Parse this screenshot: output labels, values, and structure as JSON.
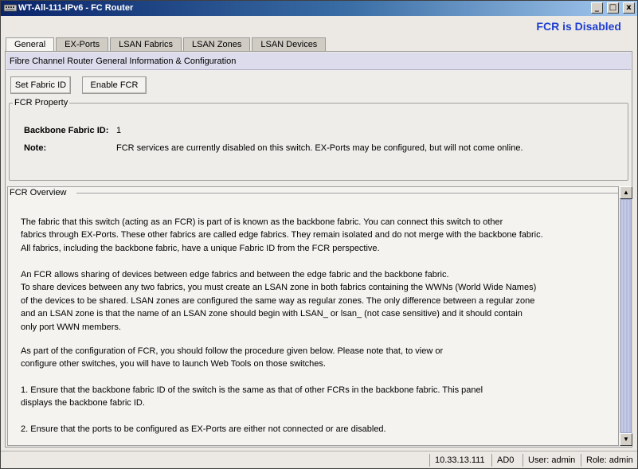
{
  "window": {
    "title": "WT-All-111-IPv6 - FC Router",
    "minimize_glyph": "_",
    "maximize_glyph": "□",
    "close_glyph": "x"
  },
  "status_banner": "FCR is Disabled",
  "tabs": [
    {
      "label": "General",
      "active": true
    },
    {
      "label": "EX-Ports",
      "active": false
    },
    {
      "label": "LSAN Fabrics",
      "active": false
    },
    {
      "label": "LSAN Zones",
      "active": false
    },
    {
      "label": "LSAN Devices",
      "active": false
    }
  ],
  "panel": {
    "header": "Fibre Channel Router General Information & Configuration",
    "buttons": {
      "set_fabric_id": "Set Fabric ID",
      "enable_fcr": "Enable FCR"
    }
  },
  "fcr_property": {
    "title": "FCR Property",
    "backbone_label": "Backbone Fabric ID:",
    "backbone_value": "1",
    "note_label": "Note:",
    "note_value": "FCR services are currently disabled on this switch. EX-Ports may be configured, but will not come online."
  },
  "overview": {
    "title": "FCR Overview",
    "paragraphs": [
      [
        "The fabric that this switch (acting as an FCR) is part of is known as the backbone fabric. You can connect this switch to other",
        "fabrics through EX-Ports. These other fabrics are called edge fabrics. They remain isolated and do not merge with the backbone fabric.",
        "All fabrics, including the backbone fabric, have a unique Fabric ID from the FCR perspective."
      ],
      [
        "An FCR allows sharing of devices between edge fabrics and between the edge fabric and the backbone fabric.",
        "To share devices between any two fabrics, you must create an LSAN zone in both fabrics containing the WWNs (World Wide Names)",
        "of the devices to be shared. LSAN zones are configured the same way as regular zones. The only difference between a regular zone",
        "and an LSAN zone is that the name of an LSAN zone should begin with LSAN_ or lsan_ (not case sensitive) and it should contain",
        "only port WWN members."
      ],
      [
        "As part of the configuration of FCR, you should follow the procedure given below. Please note that, to view or",
        "configure other switches, you will have to launch Web Tools on those switches."
      ],
      [
        "1. Ensure that the backbone fabric ID of the switch is the same as that of other FCRs in the backbone fabric. This panel",
        "displays the backbone fabric ID."
      ],
      [
        "2. Ensure that the ports to be configured as EX-Ports are either not connected or are disabled."
      ]
    ]
  },
  "scrollbar": {
    "up_glyph": "▲",
    "down_glyph": "▼"
  },
  "statusbar": {
    "ip": "10.33.13.111",
    "ad": "AD0",
    "user": "User: admin",
    "role": "Role: admin"
  }
}
